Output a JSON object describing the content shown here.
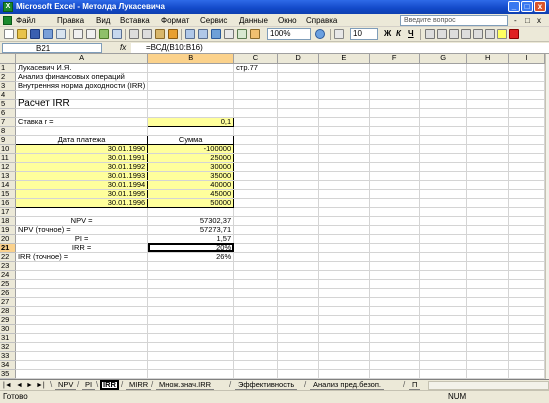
{
  "window": {
    "title": "Microsoft Excel - Метолда Лукасевича",
    "min": "_",
    "max": "□",
    "close": "x"
  },
  "menu": {
    "items": [
      "Файл",
      "Правка",
      "Вид",
      "Вставка",
      "Формат",
      "Сервис",
      "Данные",
      "Окно",
      "Справка"
    ],
    "help_placeholder": "Введите вопрос",
    "controls": [
      "-",
      "□",
      "x"
    ]
  },
  "toolbar": {
    "zoom": "100%",
    "font_size": "10",
    "bold": "Ж",
    "italic": "К",
    "underline": "Ч"
  },
  "formula_bar": {
    "cell_ref": "B21",
    "fx": "fx",
    "formula": "=ВСД(B10:B16)"
  },
  "columns": [
    "A",
    "B",
    "C",
    "D",
    "E",
    "F",
    "G",
    "H",
    "I"
  ],
  "rows": [
    "1",
    "2",
    "3",
    "4",
    "5",
    "6",
    "7",
    "8",
    "9",
    "10",
    "11",
    "12",
    "13",
    "14",
    "15",
    "16",
    "17",
    "18",
    "19",
    "20",
    "21",
    "22",
    "23",
    "24",
    "25",
    "26",
    "27",
    "28",
    "29",
    "30",
    "31",
    "32",
    "33",
    "34",
    "35"
  ],
  "cells": {
    "a1": "Лукасевич И.Я.",
    "c1": "стр.77",
    "a2": "Анализ финансовых операций",
    "a3": "Внутренняя норма доходности (IRR)",
    "a5": "Расчет IRR",
    "a7": "Ставка r =",
    "b7": "0,1",
    "a9": "Дата платежа",
    "b9": "Сумма",
    "dates": [
      "30.01.1990",
      "30.01.1991",
      "30.01.1992",
      "30.01.1993",
      "30.01.1994",
      "30.01.1995",
      "30.01.1996"
    ],
    "amounts": [
      "-100000",
      "25000",
      "30000",
      "35000",
      "40000",
      "45000",
      "50000"
    ],
    "a18": "NPV =",
    "b18": "57302,37",
    "a19": "NPV (точное) =",
    "b19": "57273,71",
    "a20": "PI =",
    "b20": "1,57",
    "a21": "IRR =",
    "b21": "20%",
    "a22": "IRR (точное) =",
    "b22": "26%"
  },
  "sheet_tabs": [
    "NPV",
    "PI",
    "IRR",
    "MIRR",
    "Множ.знач.IRR",
    "Эффективность",
    "Анализ пред.безоп.",
    "П"
  ],
  "status": {
    "ready": "Готово",
    "num": "NUM"
  }
}
